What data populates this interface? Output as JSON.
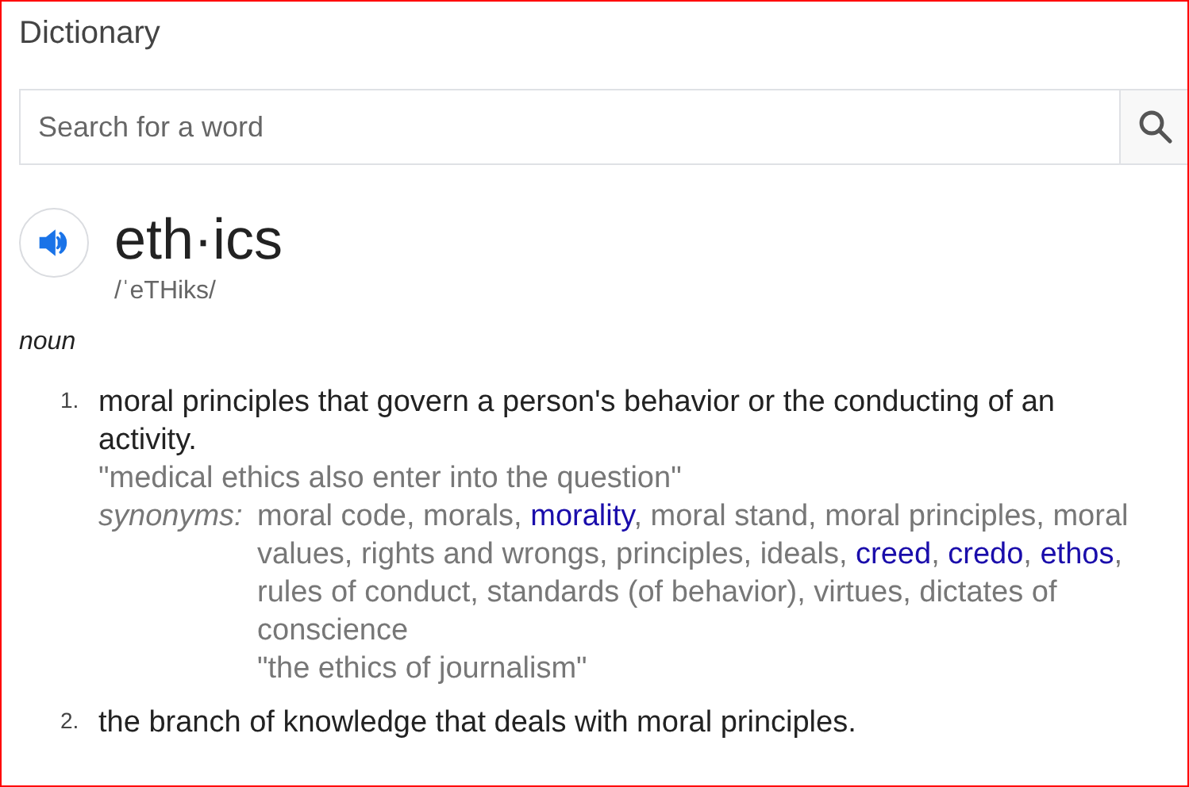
{
  "title": "Dictionary",
  "search": {
    "placeholder": "Search for a word"
  },
  "entry": {
    "word": "eth·ics",
    "phonetic": "/ˈeTHiks/",
    "part_of_speech": "noun",
    "senses": [
      {
        "number": "1.",
        "definition": "moral principles that govern a person's behavior or the conducting of an activity.",
        "example": "\"medical ethics also enter into the question\"",
        "synonyms_label": "synonyms:",
        "synonyms": [
          {
            "text": "moral code, morals, ",
            "link": false
          },
          {
            "text": "morality",
            "link": true
          },
          {
            "text": ", moral stand, moral principles, moral values, rights and wrongs, principles, ideals, ",
            "link": false
          },
          {
            "text": "creed",
            "link": true
          },
          {
            "text": ", ",
            "link": false
          },
          {
            "text": "credo",
            "link": true
          },
          {
            "text": ", ",
            "link": false
          },
          {
            "text": "ethos",
            "link": true
          },
          {
            "text": ", rules of conduct, standards (of behavior), virtues, dictates of conscience",
            "link": false
          }
        ],
        "synonym_example": "\"the ethics of journalism\""
      },
      {
        "number": "2.",
        "definition": "the branch of knowledge that deals with moral principles."
      }
    ]
  }
}
